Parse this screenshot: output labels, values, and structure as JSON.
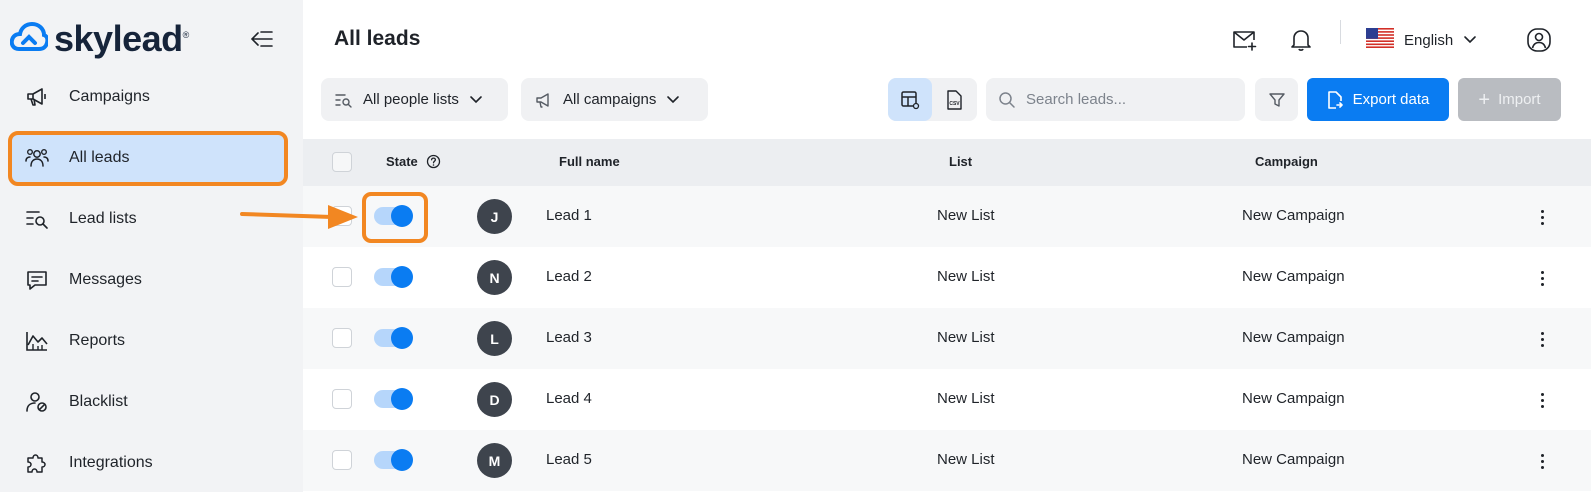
{
  "app": {
    "logo_text": "skylead",
    "logo_mark": "®"
  },
  "sidebar": {
    "items": [
      {
        "label": "Campaigns",
        "icon": "megaphone-icon"
      },
      {
        "label": "All leads",
        "icon": "users-icon",
        "active": true
      },
      {
        "label": "Lead lists",
        "icon": "list-search-icon"
      },
      {
        "label": "Messages",
        "icon": "message-icon"
      },
      {
        "label": "Reports",
        "icon": "chart-icon"
      },
      {
        "label": "Blacklist",
        "icon": "user-block-icon"
      },
      {
        "label": "Integrations",
        "icon": "puzzle-icon"
      }
    ]
  },
  "header": {
    "title": "All leads",
    "language": "English"
  },
  "toolbar": {
    "people_lists_label": "All people lists",
    "campaigns_label": "All campaigns",
    "search_placeholder": "Search leads...",
    "export_label": "Export data",
    "import_label": "Import"
  },
  "table": {
    "headers": {
      "state": "State",
      "full_name": "Full name",
      "list": "List",
      "campaign": "Campaign"
    },
    "rows": [
      {
        "initial": "J",
        "name": "Lead 1",
        "list": "New List",
        "campaign": "New Campaign",
        "state_on": true
      },
      {
        "initial": "N",
        "name": "Lead 2",
        "list": "New List",
        "campaign": "New Campaign",
        "state_on": true
      },
      {
        "initial": "L",
        "name": "Lead 3",
        "list": "New List",
        "campaign": "New Campaign",
        "state_on": true
      },
      {
        "initial": "D",
        "name": "Lead 4",
        "list": "New List",
        "campaign": "New Campaign",
        "state_on": true
      },
      {
        "initial": "M",
        "name": "Lead 5",
        "list": "New List",
        "campaign": "New Campaign",
        "state_on": true
      }
    ]
  },
  "colors": {
    "accent": "#0a7cf2",
    "highlight": "#f28722",
    "active_nav_bg": "#cfe3fb",
    "sidebar_bg": "#f2f3f5"
  }
}
